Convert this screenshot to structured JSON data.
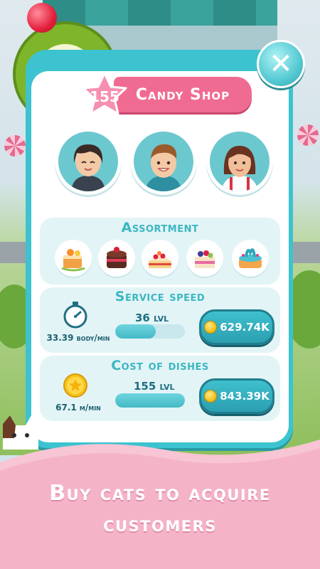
{
  "shop": {
    "level": "155",
    "title": "Candy Shop"
  },
  "close": {
    "icon": "close-icon"
  },
  "staff": [
    {
      "name": "staff-woman-1"
    },
    {
      "name": "staff-man"
    },
    {
      "name": "staff-woman-2"
    }
  ],
  "assortment": {
    "title": "Assortment",
    "dishes": [
      "orange-cake",
      "chocolate-cake",
      "strawberry-cake",
      "berry-cake",
      "blue-swirl-cake"
    ]
  },
  "service_speed": {
    "title": "Service speed",
    "stat": "33.39 body/min",
    "level": "36 lvl",
    "progress": 0.58,
    "price": "629.74K"
  },
  "cost_of_dishes": {
    "title": "Cost of dishes",
    "stat": "67.1 m/min",
    "level": "155 lvl",
    "progress": 1.0,
    "price": "843.39K"
  },
  "footer": {
    "line1": "Buy cats to acquire",
    "line2": "customers"
  },
  "colors": {
    "panel": "#3cc3cf",
    "ribbon": "#f06b92",
    "accent_text": "#3bb7c2",
    "footer_pink": "#f7c5d4"
  }
}
